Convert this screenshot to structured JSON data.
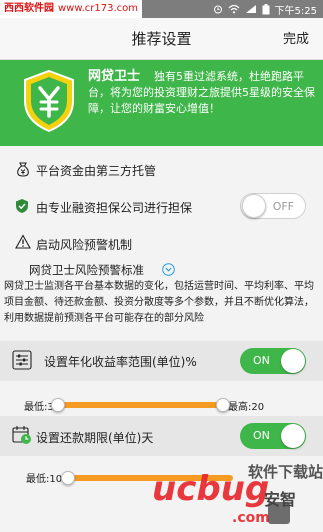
{
  "status_bar": {
    "watermark_name": "西西软件园",
    "watermark_url": "www.cr173.com",
    "time": "下午5:25"
  },
  "header": {
    "title": "推荐设置",
    "done_label": "完成"
  },
  "banner": {
    "name": "网贷卫士",
    "description": "独有5重过滤系统，杜绝跑路平台，将为您的投资理财之旅提供5星级的安全保障，让您的财富安心增值！"
  },
  "options": {
    "custody": {
      "label": "平台资金由第三方托管"
    },
    "guarantee": {
      "label": "由专业融资担保公司进行担保",
      "toggle": "OFF"
    },
    "risk": {
      "label": "启动风险预警机制"
    }
  },
  "standard": {
    "label": "网贷卫士风险预警标准",
    "paragraph": "网贷卫士监测各平台基本数据的变化，包括运营时间、平均利率、平均项目金额、待还款金额、投资分散度等多个参数，并且不断优化算法，利用数据提前预测各平台可能存在的部分风险"
  },
  "yield_setting": {
    "label": "设置年化收益率范围(单位)%",
    "toggle": "ON",
    "min_label": "最低:3",
    "max_label": "最高:20",
    "min_fraction": 0.0,
    "max_fraction": 1.0
  },
  "term_setting": {
    "label": "设置还款期限(单位)天",
    "toggle": "ON",
    "min_label": "最低:10",
    "min_fraction": 0.0
  },
  "bottom_watermark": {
    "text": "软件下载站",
    "brand": "安智"
  },
  "colors": {
    "green": "#3fb649",
    "orange": "#f59a23",
    "band": "#e6e6e6"
  }
}
